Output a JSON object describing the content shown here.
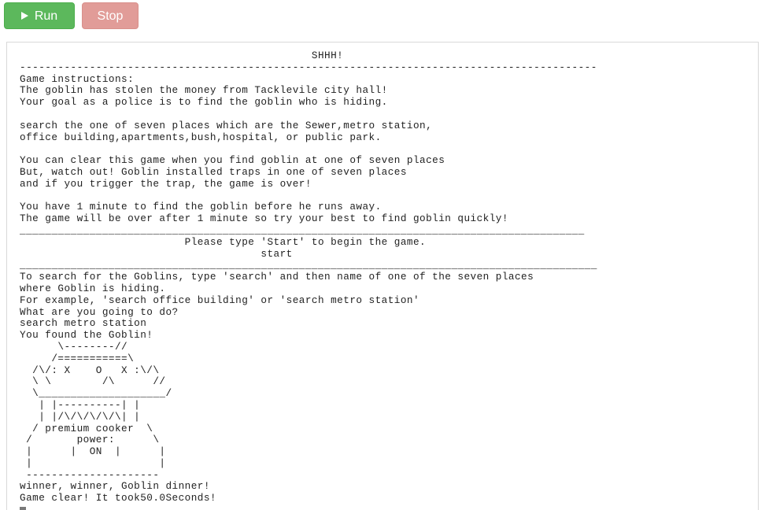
{
  "toolbar": {
    "run_label": "Run",
    "stop_label": "Stop"
  },
  "console": {
    "output_text": "                                              SHHH!\n-------------------------------------------------------------------------------------------\nGame instructions:\nThe goblin has stolen the money from Tacklevile city hall!\nYour goal as a police is to find the goblin who is hiding.\n\nsearch the one of seven places which are the Sewer,metro station,\noffice building,apartments,bush,hospital, or public park.\n\nYou can clear this game when you find goblin at one of seven places\nBut, watch out! Goblin installed traps in one of seven places\nand if you trigger the trap, the game is over!\n\nYou have 1 minute to find the goblin before he runs away.\nThe game will be over after 1 minute so try your best to find goblin quickly!\n_________________________________________________________________________________________\n                          Please type 'Start' to begin the game.\n                                      start\n___________________________________________________________________________________________\nTo search for the Goblins, type 'search' and then name of one of the seven places\nwhere Goblin is hiding.\nFor example, 'search office building' or 'search metro station'\nWhat are you going to do?\nsearch metro station\nYou found the Goblin!\n      \\--------//\n     /===========\\\n  /\\/: X    O   X :\\/\\\n  \\ \\        /\\      //\n  \\____________________/\n   | |----------| |\n   | |/\\/\\/\\/\\/\\| |\n  / premium cooker  \\\n /       power:      \\\n |      |  ON  |      |\n |                    |\n ---------------------\nwinner, winner, Goblin dinner!\nGame clear! It took50.0Seconds!"
  }
}
